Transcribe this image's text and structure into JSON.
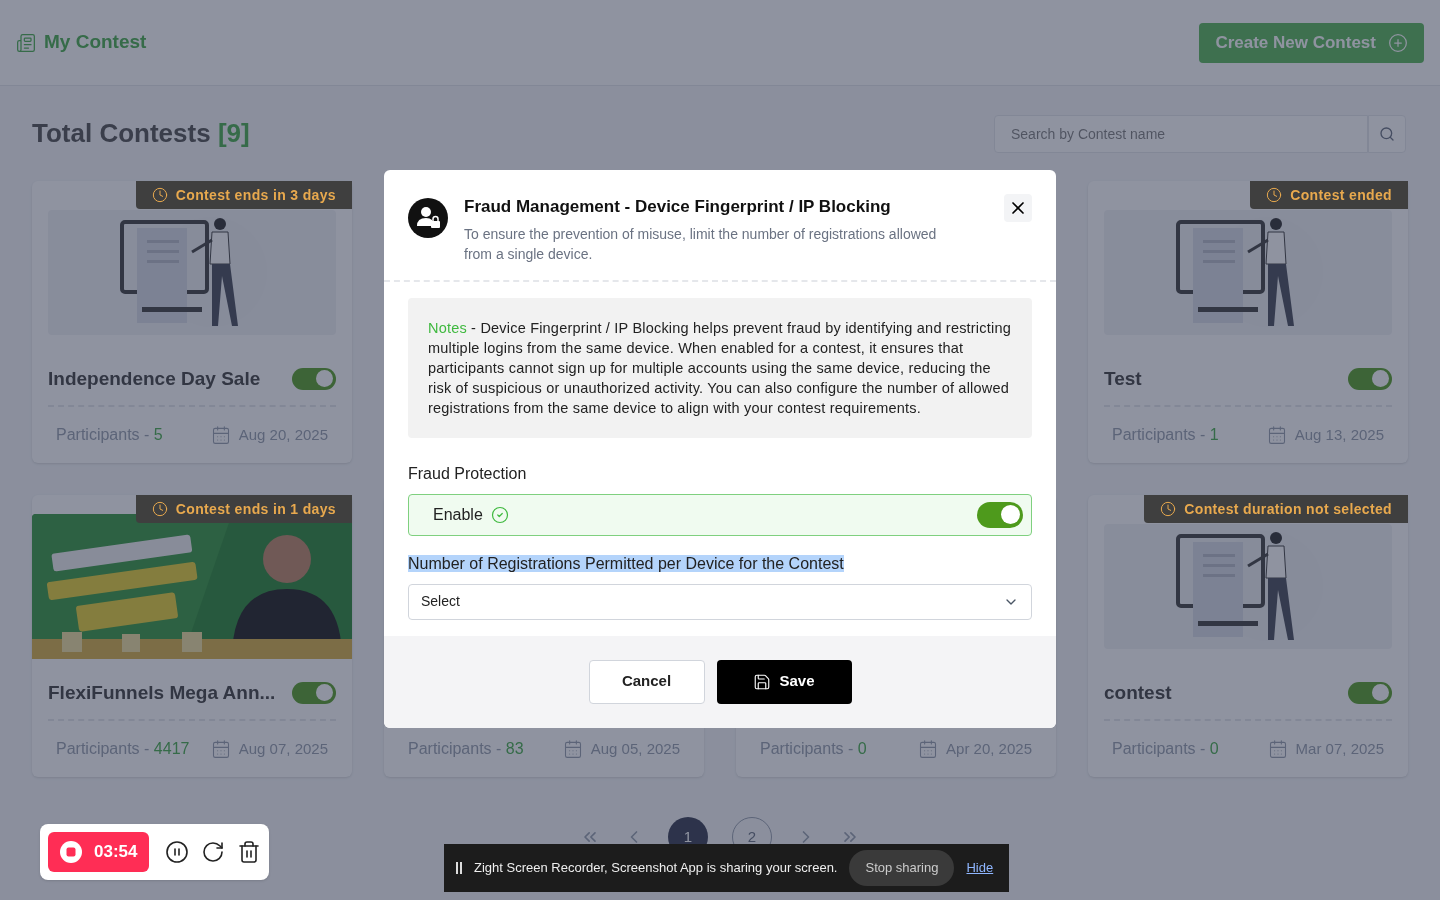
{
  "header": {
    "title": "My Contest",
    "create_button": "Create New Contest"
  },
  "summary": {
    "label": "Total Contests",
    "count": "[9]"
  },
  "search": {
    "placeholder": "Search by Contest name"
  },
  "cards": [
    {
      "kind": "illustration",
      "badge": "Contest ends in 3 days",
      "title": "Independence Day Sale",
      "on": true,
      "participants_label": "Participants -",
      "participants": "5",
      "date": "Aug 20, 2025"
    },
    {
      "kind": "illustration",
      "badge": "Contest ended",
      "title": "Test",
      "on": true,
      "participants_label": "Participants -",
      "participants": "1",
      "date": "Aug 13, 2025"
    },
    {
      "kind": "banner",
      "badge": "Contest ends in 1 days",
      "title": "FlexiFunnels Mega Ann...",
      "on": true,
      "participants_label": "Participants -",
      "participants": "4417",
      "date": "Aug 07, 2025"
    },
    {
      "kind": "footer_only",
      "participants_label": "Participants -",
      "participants": "83",
      "date": "Aug 05, 2025"
    },
    {
      "kind": "footer_only",
      "participants_label": "Participants -",
      "participants": "0",
      "date": "Apr 20, 2025"
    },
    {
      "kind": "illustration",
      "badge": "Contest duration not selected",
      "title": "contest",
      "on": true,
      "participants_label": "Participants -",
      "participants": "0",
      "date": "Mar 07, 2025"
    }
  ],
  "pagination": {
    "pages": [
      {
        "label": "1",
        "selected": true
      },
      {
        "label": "2",
        "selected": false
      }
    ]
  },
  "modal": {
    "title": "Fraud Management - Device Fingerprint / IP Blocking",
    "description": "To ensure the prevention of misuse, limit the number of registrations allowed from a single device.",
    "notes_label": "Notes",
    "notes_text": " - Device Fingerprint / IP Blocking helps prevent fraud by identifying and restricting multiple logins from the same device. When enabled for a contest, it ensures that participants cannot sign up for multiple accounts using the same device, reducing the risk of suspicious or unauthorized activity. You can also configure the number of allowed registrations from the same device to align with your contest requirements.",
    "section_label": "Fraud Protection",
    "enable": {
      "label": "Enable",
      "verified": true,
      "on": true
    },
    "field": {
      "label": "Number of Registrations Permitted per Device for the Contest",
      "highlighted": true,
      "placeholder": "Select"
    },
    "buttons": {
      "cancel": "Cancel",
      "save": "Save"
    }
  },
  "recorder": {
    "time": "03:54"
  },
  "share_bar": {
    "message": "Zight Screen Recorder, Screenshot App is sharing your screen.",
    "stop": "Stop sharing",
    "hide": "Hide"
  }
}
